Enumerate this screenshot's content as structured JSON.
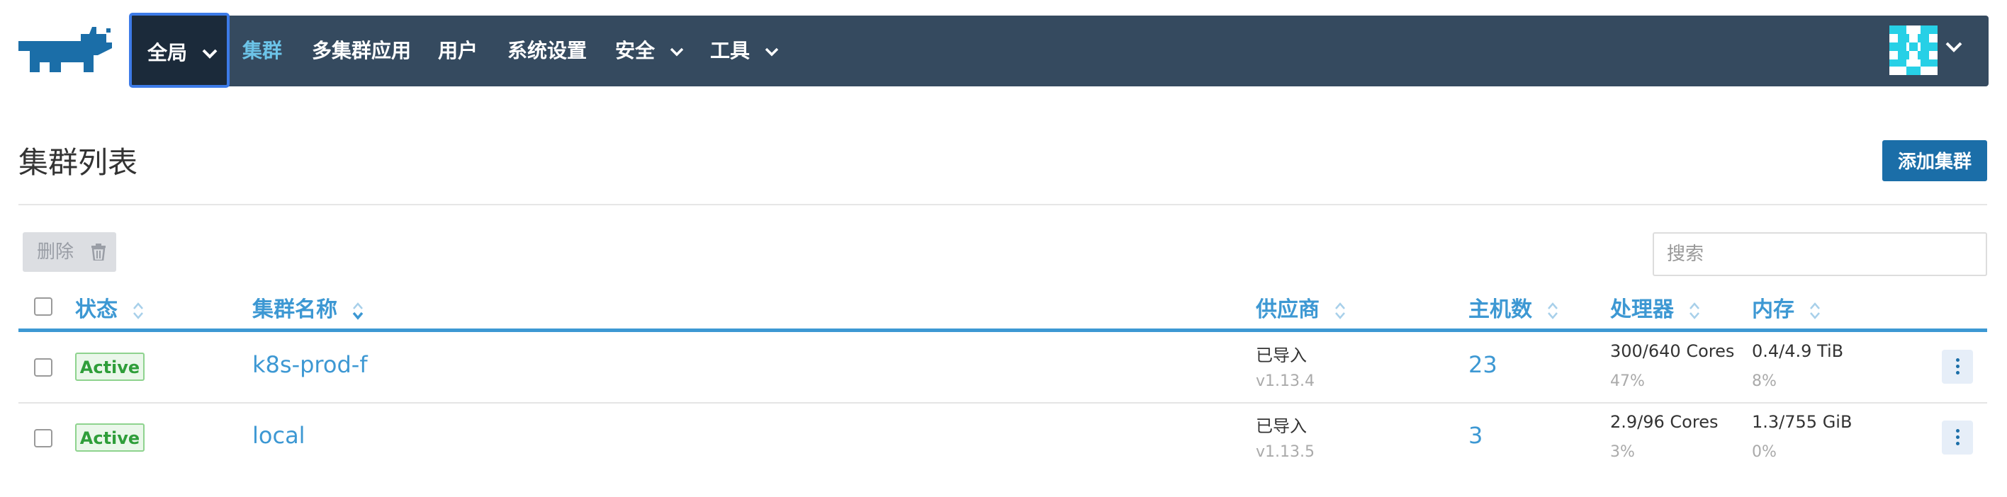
{
  "nav": {
    "items": [
      {
        "label": "全局"
      },
      {
        "label": "集群"
      },
      {
        "label": "多集群应用"
      },
      {
        "label": "用户"
      },
      {
        "label": "系统设置"
      },
      {
        "label": "安全"
      },
      {
        "label": "工具"
      }
    ],
    "icons": [
      "rancher-logo-icon",
      "user-avatar-icon",
      "chevron-down-icon"
    ],
    "colors": {
      "bar": "#354a5f",
      "active": "#6cc4e8",
      "focus": "#3d7be8"
    }
  },
  "page": {
    "title": "集群列表",
    "add_button": "添加集群",
    "delete_button": "删除",
    "search_placeholder": "搜索"
  },
  "table": {
    "columns": [
      "状态",
      "集群名称",
      "供应商",
      "主机数",
      "处理器",
      "内存"
    ],
    "rows": [
      {
        "status": "Active",
        "name": "k8s-prod-f",
        "provider": "已导入",
        "version": "v1.13.4",
        "hosts": "23",
        "cpu": "300/640 Cores",
        "cpu_pct": "47%",
        "memory": "0.4/4.9 TiB",
        "memory_pct": "8%"
      },
      {
        "status": "Active",
        "name": "local",
        "provider": "已导入",
        "version": "v1.13.5",
        "hosts": "3",
        "cpu": "2.9/96 Cores",
        "cpu_pct": "3%",
        "memory": "1.3/755 GiB",
        "memory_pct": "0%"
      }
    ],
    "colors": {
      "link": "#3d98d3",
      "active_badge": "#2f9e3a",
      "primary_button": "#1b6ea8"
    }
  }
}
